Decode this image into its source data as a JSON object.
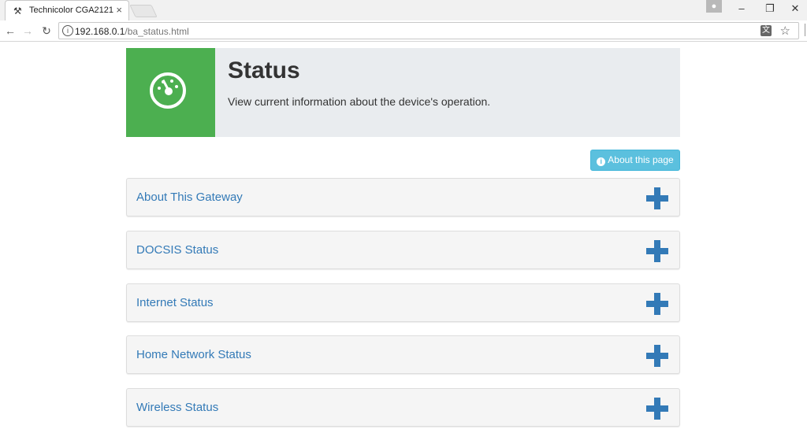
{
  "browser": {
    "tab_title": "Technicolor CGA2121",
    "tab_close": "×",
    "url_host": "192.168.0.1",
    "url_path": "/ba_status.html"
  },
  "hero": {
    "title": "Status",
    "subtitle": "View current information about the device's operation."
  },
  "about_button": {
    "label": "About this page",
    "icon": "info-icon"
  },
  "panels": [
    {
      "title": "About This Gateway"
    },
    {
      "title": "DOCSIS Status"
    },
    {
      "title": "Internet Status"
    },
    {
      "title": "Home Network Status"
    },
    {
      "title": "Wireless Status"
    }
  ],
  "colors": {
    "hero_accent": "#4caf50",
    "link": "#337ab7",
    "info_button": "#5bc0de"
  }
}
